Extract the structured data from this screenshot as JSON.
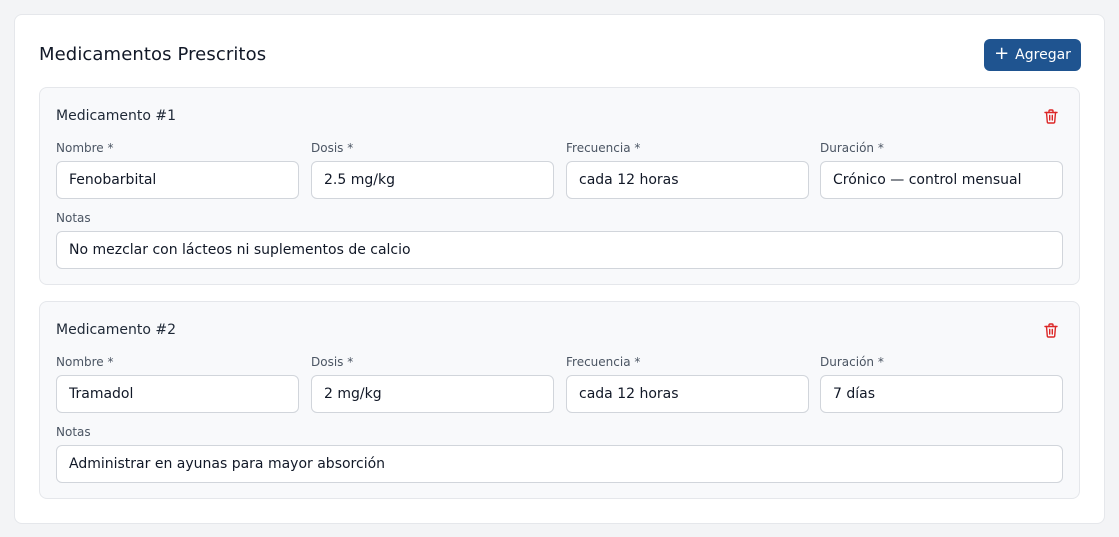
{
  "section": {
    "title": "Medicamentos Prescritos",
    "add_button": {
      "icon": "plus-icon",
      "icon_glyph": "+",
      "label": "Agregar"
    }
  },
  "labels": {
    "nombre": "Nombre *",
    "dosis": "Dosis *",
    "frecuencia": "Frecuencia *",
    "duracion": "Duración *",
    "notas": "Notas"
  },
  "medications": [
    {
      "title": "Medicamento #1",
      "delete_icon": "trash-icon",
      "nombre": "Fenobarbital",
      "dosis": "2.5 mg/kg",
      "frecuencia": "cada 12 horas",
      "duracion": "Crónico — control mensual",
      "notas": "No mezclar con lácteos ni suplementos de calcio"
    },
    {
      "title": "Medicamento #2",
      "delete_icon": "trash-icon",
      "nombre": "Tramadol",
      "dosis": "2 mg/kg",
      "frecuencia": "cada 12 horas",
      "duracion": "7 días",
      "notas": "Administrar en ayunas para mayor absorción"
    }
  ],
  "colors": {
    "primary": "#1f5490",
    "danger": "#dc2626",
    "card_background": "#f8f9fb",
    "border": "#e5e7eb"
  }
}
